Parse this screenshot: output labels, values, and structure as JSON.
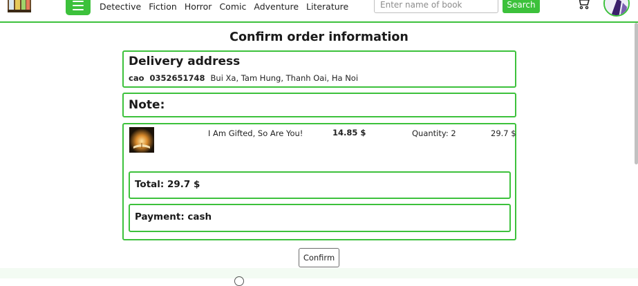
{
  "header": {
    "logo_icon": "bookshelf-logo-icon",
    "menu_icon": "hamburger-icon",
    "nav": [
      "Detective",
      "Fiction",
      "Horror",
      "Comic",
      "Adventure",
      "Literature"
    ],
    "search": {
      "placeholder": "Enter name of book",
      "value": "",
      "button_label": "Search"
    },
    "cart_icon": "cart-icon",
    "avatar_icon": "user-avatar",
    "accent_color": "#3cc13b"
  },
  "page": {
    "title": "Confirm order information",
    "address": {
      "heading": "Delivery address",
      "name": "cao",
      "phone": "0352651748",
      "location": "Bui Xa, Tam Hung, Thanh Oai, Ha Noi"
    },
    "note": {
      "label": "Note:"
    },
    "items": [
      {
        "name": "I Am Gifted, So Are You!",
        "price": "14.85 $",
        "quantity": "Quantity: 2",
        "subtotal": "29.7 $",
        "thumb_icon": "book-cover-image"
      }
    ],
    "total": "Total: 29.7 $",
    "payment": "Payment: cash",
    "confirm_label": "Confirm"
  }
}
